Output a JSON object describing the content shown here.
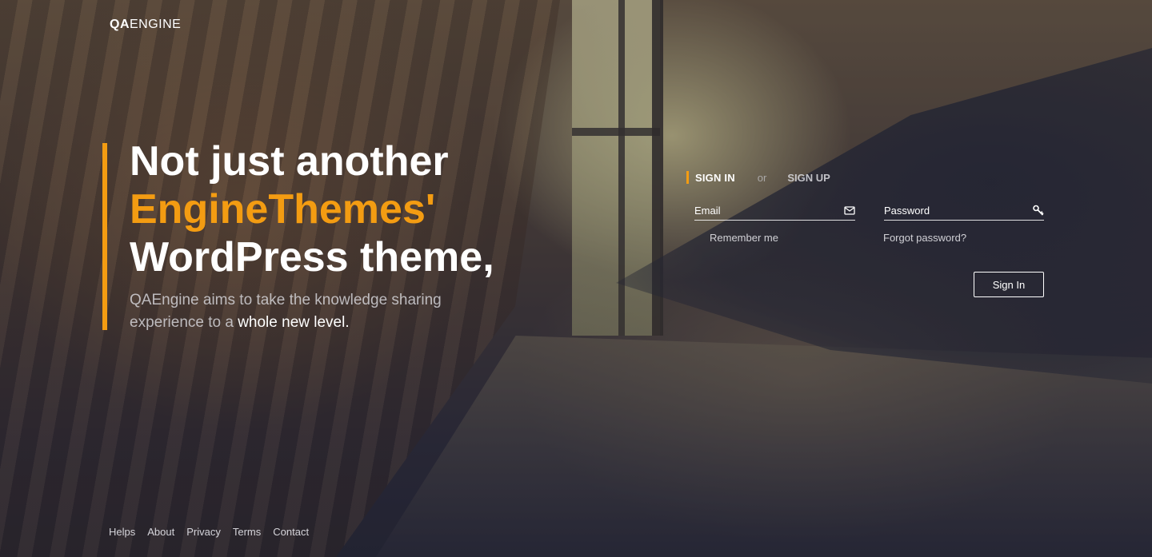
{
  "brand": {
    "logo_strong": "QA",
    "logo_light": "ENGINE"
  },
  "hero": {
    "line1": "Not just another",
    "line2": "EngineThemes'",
    "line3": "WordPress theme,",
    "tagline_start": "QAEngine aims to take the knowledge sharing experience to a",
    "tagline_emphasis": "whole new level."
  },
  "auth": {
    "tab_signin": "SIGN IN",
    "tab_or": "or",
    "tab_signup": "SIGN UP",
    "email_placeholder": "Email",
    "password_placeholder": "Password",
    "remember_label": "Remember me",
    "forgot_label": "Forgot password?",
    "signin_button": "Sign In"
  },
  "footer": {
    "links": [
      "Helps",
      "About",
      "Privacy",
      "Terms",
      "Contact"
    ]
  },
  "colors": {
    "accent": "#f39c12",
    "text": "#ffffff"
  },
  "icons": {
    "email": "envelope-icon",
    "password": "key-icon"
  }
}
